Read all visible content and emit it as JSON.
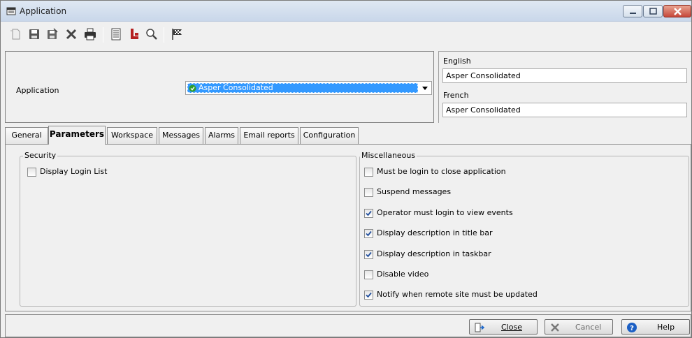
{
  "window": {
    "title": "Application"
  },
  "toolbar": {
    "buttons": [
      {
        "name": "new-icon"
      },
      {
        "name": "save-icon"
      },
      {
        "name": "save-close-icon"
      },
      {
        "name": "delete-icon"
      },
      {
        "name": "print-icon"
      },
      {
        "name": "list-icon"
      },
      {
        "name": "links-icon"
      },
      {
        "name": "search-icon"
      },
      {
        "name": "flag-icon"
      }
    ]
  },
  "header": {
    "app_label": "Application",
    "app_value": "Asper Consolidated",
    "english_label": "English",
    "english_value": "Asper Consolidated",
    "french_label": "French",
    "french_value": "Asper Consolidated"
  },
  "tabs": [
    {
      "label": "General",
      "active": false
    },
    {
      "label": "Parameters",
      "active": true
    },
    {
      "label": "Workspace",
      "active": false
    },
    {
      "label": "Messages",
      "active": false
    },
    {
      "label": "Alarms",
      "active": false
    },
    {
      "label": "Email reports",
      "active": false
    },
    {
      "label": "Configuration",
      "active": false
    }
  ],
  "security": {
    "title": "Security",
    "items": [
      {
        "label": "Display Login List",
        "checked": false
      }
    ]
  },
  "misc": {
    "title": "Miscellaneous",
    "items": [
      {
        "label": "Must be login to close application",
        "checked": false
      },
      {
        "label": "Suspend messages",
        "checked": false
      },
      {
        "label": "Operator must login to view events",
        "checked": true
      },
      {
        "label": "Display description in title bar",
        "checked": true
      },
      {
        "label": "Display description in taskbar",
        "checked": true
      },
      {
        "label": "Disable video",
        "checked": false
      },
      {
        "label": "Notify when remote site must be updated",
        "checked": true
      }
    ]
  },
  "buttons": {
    "close": "Close",
    "cancel": "Cancel",
    "help": "Help"
  },
  "colors": {
    "selection": "#3399ff",
    "titlebar": "#c9d7ea"
  }
}
